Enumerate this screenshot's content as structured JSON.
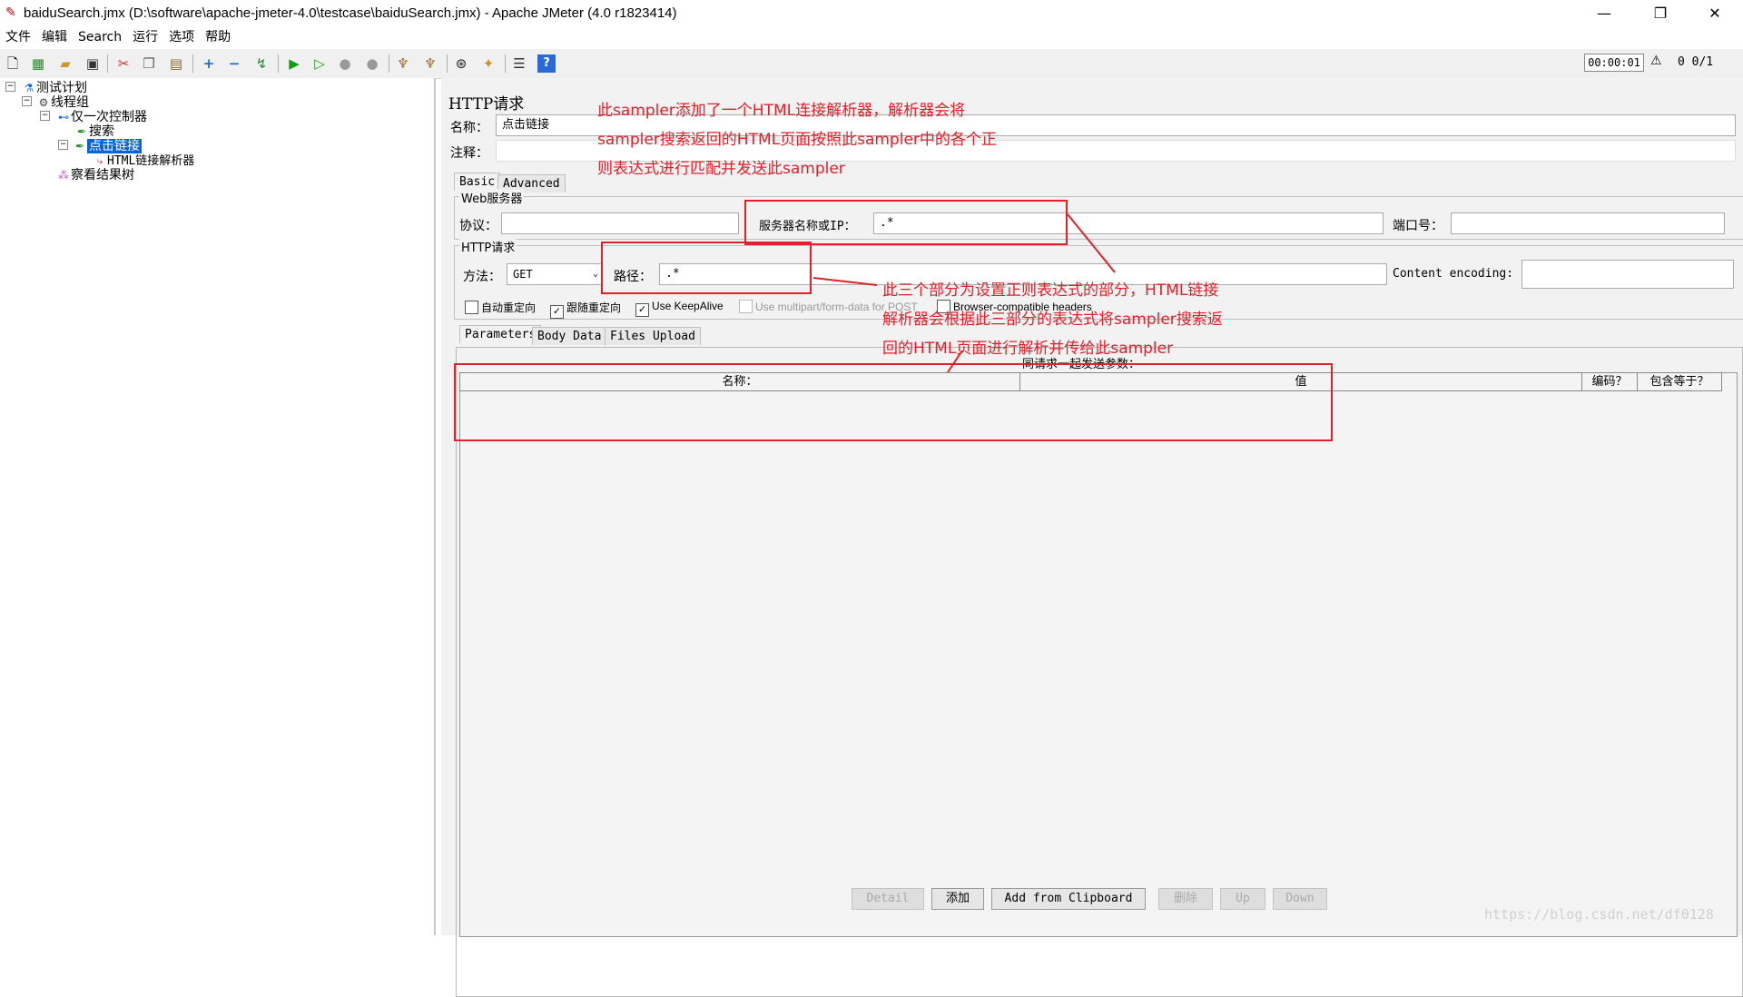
{
  "window": {
    "title": "baiduSearch.jmx (D:\\software\\apache-jmeter-4.0\\testcase\\baiduSearch.jmx) - Apache JMeter (4.0 r1823414)",
    "minimize": "—",
    "maximize": "❐",
    "close": "✕"
  },
  "menu": [
    "文件",
    "编辑",
    "Search",
    "运行",
    "选项",
    "帮助"
  ],
  "toolbar": {
    "timer": "00:00:01",
    "warning_count": "0",
    "threads": "0/1"
  },
  "tree": {
    "root": "测试计划",
    "thread_group": "线程组",
    "controller": "仅一次控制器",
    "sampler_search": "搜索",
    "sampler_click": "点击链接",
    "html_parser": "HTML链接解析器",
    "results_tree": "察看结果树"
  },
  "panel": {
    "title": "HTTP请求",
    "name_label": "名称：",
    "name_value": "点击链接",
    "comment_label": "注释：",
    "tabs": [
      "Basic",
      "Advanced"
    ],
    "web_server_group": "Web服务器",
    "protocol_label": "协议：",
    "protocol_value": "",
    "server_label": "服务器名称或IP：",
    "server_value": ".*",
    "port_label": "端口号：",
    "port_value": "",
    "http_request_group": "HTTP请求",
    "method_label": "方法：",
    "method_value": "GET",
    "path_label": "路径：",
    "path_value": ".*",
    "encoding_label": "Content encoding:",
    "encoding_value": "",
    "checkboxes": {
      "auto_redirect": "自动重定向",
      "follow_redirect": "跟随重定向",
      "keepalive": "Use KeepAlive",
      "multipart": "Use multipart/form-data for POST",
      "browser_headers": "Browser-compatible headers"
    },
    "subtabs": [
      "Parameters",
      "Body Data",
      "Files Upload"
    ],
    "params_caption": "同请求一起发送参数：",
    "columns": [
      "名称：",
      "值",
      "编码？",
      "包含等于？"
    ],
    "buttons": {
      "detail": "Detail",
      "add": "添加",
      "clipboard": "Add from Clipboard",
      "delete": "删除",
      "up": "Up",
      "down": "Down"
    }
  },
  "annotations": {
    "top_line1": "此sampler添加了一个HTML连接解析器，解析器会将",
    "top_line2": "sampler搜索返回的HTML页面按照此sampler中的各个正",
    "top_line3": "则表达式进行匹配并发送此sampler",
    "mid_line1": "此三个部分为设置正则表达式的部分，HTML链接",
    "mid_line2": "解析器会根据此三部分的表达式将sampler搜索返",
    "mid_line3": "回的HTML页面进行解析并传给此sampler"
  },
  "watermark": "https://blog.csdn.net/df0128",
  "colors": {
    "annotation_red": "#e0202a",
    "selection_blue": "#0a64d8"
  }
}
